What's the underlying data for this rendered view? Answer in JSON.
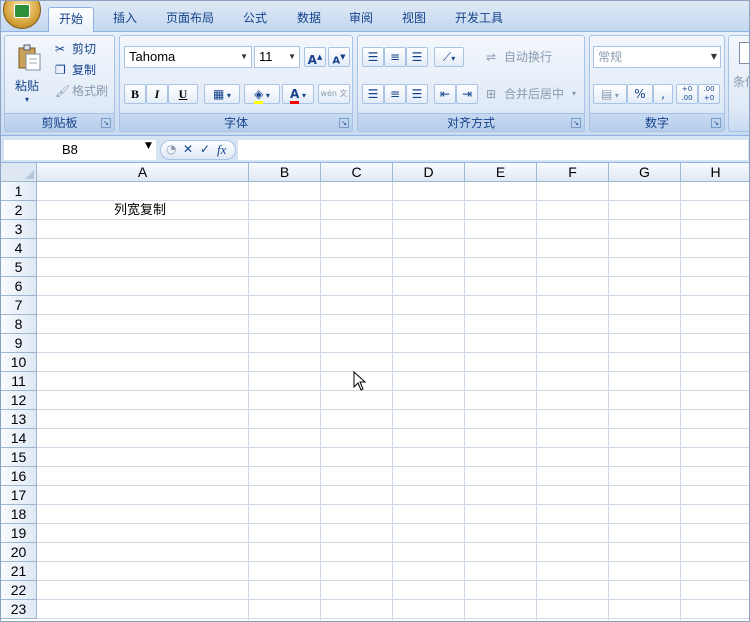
{
  "tabs": [
    {
      "label": "开始",
      "active": true
    },
    {
      "label": "插入"
    },
    {
      "label": "页面布局"
    },
    {
      "label": "公式"
    },
    {
      "label": "数据"
    },
    {
      "label": "审阅"
    },
    {
      "label": "视图"
    },
    {
      "label": "开发工具"
    }
  ],
  "ribbon": {
    "clipboard": {
      "group_label": "剪贴板",
      "paste": "粘贴",
      "cut": "剪切",
      "copy": "复制",
      "format_painter": "格式刷"
    },
    "font": {
      "group_label": "字体",
      "font_name": "Tahoma",
      "font_size": "11",
      "bold": "B",
      "italic": "I",
      "underline": "U",
      "phonetic": "wén 文"
    },
    "alignment": {
      "group_label": "对齐方式",
      "wrap_text": "自动换行",
      "merge_center": "合并后居中"
    },
    "number": {
      "group_label": "数字",
      "format": "常规",
      "percent": "%",
      "comma": ",",
      "inc_decimal": "+0 .00",
      "dec_decimal": ".00 +0"
    },
    "styles": {
      "partial_label": "条件"
    }
  },
  "formula_bar": {
    "name_box": "B8",
    "cancel": "✕",
    "enter": "✓",
    "fx": "fx",
    "content": ""
  },
  "grid": {
    "columns": [
      "A",
      "B",
      "C",
      "D",
      "E",
      "F",
      "G",
      "H"
    ],
    "rows": [
      "1",
      "2",
      "3",
      "4",
      "5",
      "6",
      "7",
      "8",
      "9",
      "10",
      "11",
      "12",
      "13",
      "14",
      "15",
      "16",
      "17",
      "18",
      "19",
      "20",
      "21",
      "22",
      "23"
    ],
    "cells": {
      "A2": "列宽复制"
    }
  },
  "colors": {
    "ribbon_text": "#15428b",
    "grid_line": "#d0d7e5",
    "header_border": "#9eb6ce"
  }
}
